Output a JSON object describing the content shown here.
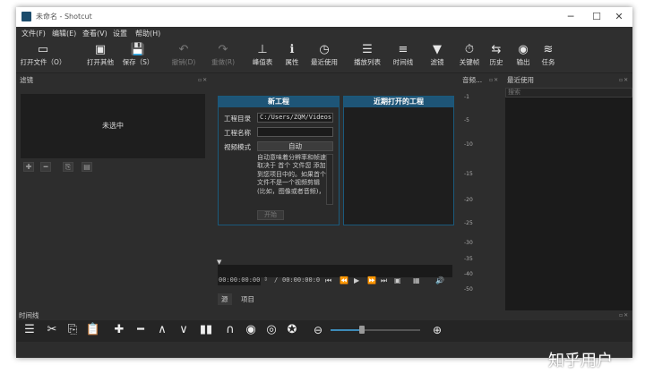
{
  "window": {
    "title": "未命名 - Shotcut",
    "controls": {
      "minimize": "─",
      "maximize": "☐",
      "close": "✕"
    }
  },
  "menu": [
    "文件(F)",
    "编辑(E)",
    "查看(V)",
    "设置",
    "帮助(H)"
  ],
  "toolbar": [
    {
      "label": "打开文件（O）",
      "icon": "open-file-icon",
      "glyph": "▭",
      "disabled": false
    },
    {
      "label": "打开其他",
      "icon": "open-other-icon",
      "glyph": "▣",
      "disabled": false
    },
    {
      "label": "保存（S）",
      "icon": "save-icon",
      "glyph": "💾",
      "disabled": false
    },
    {
      "label": "撤销(D)",
      "icon": "undo-icon",
      "glyph": "↶",
      "disabled": true
    },
    {
      "label": "重做(R)",
      "icon": "redo-icon",
      "glyph": "↷",
      "disabled": true
    },
    {
      "label": "峰值表",
      "icon": "peak-meter-icon",
      "glyph": "⊥",
      "disabled": false
    },
    {
      "label": "属性",
      "icon": "properties-icon",
      "glyph": "ℹ",
      "disabled": false
    },
    {
      "label": "最近使用",
      "icon": "recent-icon",
      "glyph": "◷",
      "disabled": false
    },
    {
      "label": "播放列表",
      "icon": "playlist-icon",
      "glyph": "☰",
      "disabled": false
    },
    {
      "label": "时间线",
      "icon": "timeline-icon",
      "glyph": "≡",
      "disabled": false
    },
    {
      "label": "滤镜",
      "icon": "filter-icon",
      "glyph": "▼",
      "disabled": false
    },
    {
      "label": "关键帧",
      "icon": "keyframes-icon",
      "glyph": "⏱",
      "disabled": false
    },
    {
      "label": "历史",
      "icon": "history-icon",
      "glyph": "⇆",
      "disabled": false
    },
    {
      "label": "输出",
      "icon": "export-icon",
      "glyph": "◉",
      "disabled": false
    },
    {
      "label": "任务",
      "icon": "jobs-icon",
      "glyph": "≋",
      "disabled": false
    }
  ],
  "panels": {
    "filters": "滤镜",
    "meter": "音频...",
    "history": "最近使用",
    "timeline": "时间线"
  },
  "filters": {
    "empty": "未选中",
    "buttons": [
      "✚",
      "━",
      "⎘",
      "▤"
    ]
  },
  "new_project": {
    "title": "新工程",
    "dir_label": "工程目录",
    "dir_value": "C:/Users/ZQM/Videos",
    "name_label": "工程名称",
    "name_value": "",
    "mode_label": "视频模式",
    "mode_value": "自动",
    "description": "自动意味着分辨率和帧速取决于 首个 文件您 添加 到您项目中的。如果首个文件不是一个视频剪辑(比如，图像或者音频)，",
    "start": "开始"
  },
  "recent_projects": {
    "title": "近期打开的工程"
  },
  "player": {
    "timecode": "00:00:00:00",
    "duration": "00:00:00:00",
    "separator": "/",
    "tabs": [
      "源",
      "项目"
    ]
  },
  "meter_ticks": [
    "-1",
    "-5",
    "-10",
    "-15",
    "-20",
    "-25",
    "-30",
    "-35",
    "-40",
    "-50"
  ],
  "history": {
    "search_placeholder": "搜索"
  },
  "timeline_tools": [
    {
      "name": "menu-icon",
      "glyph": "☰"
    },
    {
      "name": "cut-icon",
      "glyph": "✂"
    },
    {
      "name": "copy-icon",
      "glyph": "⎘"
    },
    {
      "name": "paste-icon",
      "glyph": "📋"
    },
    {
      "name": "append-icon",
      "glyph": "✚"
    },
    {
      "name": "remove-icon",
      "glyph": "━"
    },
    {
      "name": "lift-icon",
      "glyph": "∧"
    },
    {
      "name": "overwrite-icon",
      "glyph": "∨"
    },
    {
      "name": "split-icon",
      "glyph": "▮▮"
    },
    {
      "name": "snap-icon",
      "glyph": "∩"
    },
    {
      "name": "scrub-icon",
      "glyph": "◉"
    },
    {
      "name": "ripple-icon",
      "glyph": "◎"
    },
    {
      "name": "ripple-all-icon",
      "glyph": "✪"
    }
  ],
  "zoom": {
    "level": 0.35
  },
  "watermark": "知乎用户"
}
